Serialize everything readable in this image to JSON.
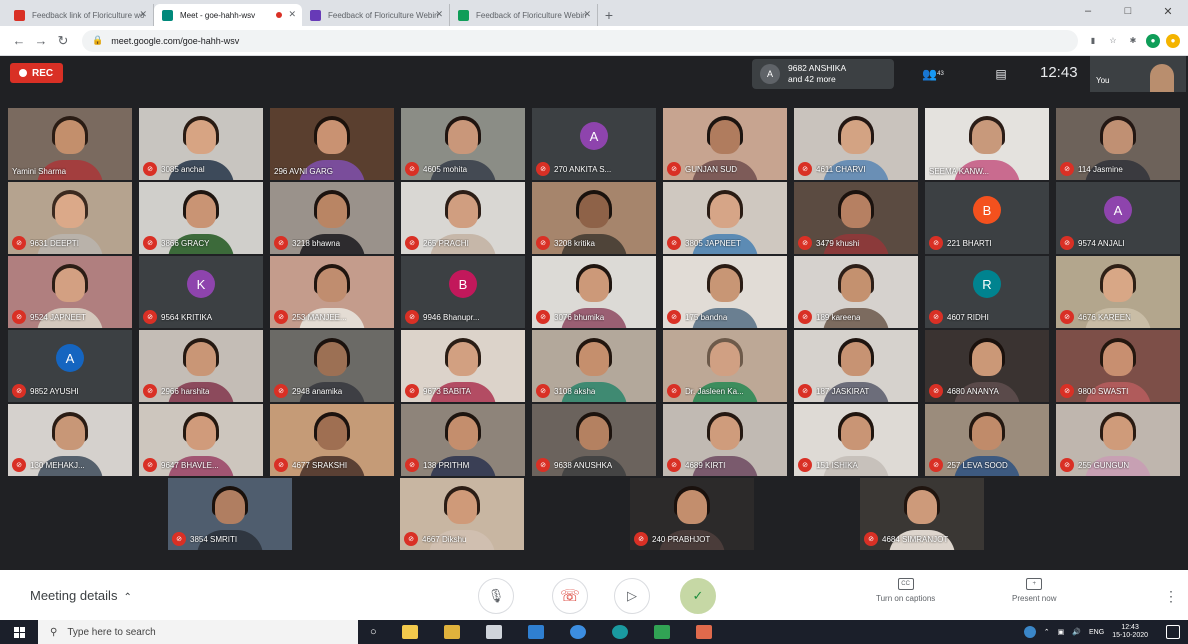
{
  "browser": {
    "tabs": [
      {
        "label": "Feedback link of Floriculture wo",
        "fav_color": "#d93025",
        "active": false
      },
      {
        "label": "Meet - goe-hahh-wsv",
        "fav_color": "#00897b",
        "active": true
      },
      {
        "label": "Feedback of Floriculture Webin",
        "fav_color": "#673ab7",
        "active": false
      },
      {
        "label": "Feedback of Floriculture Webin",
        "fav_color": "#0f9d58",
        "active": false
      }
    ],
    "url": "meet.google.com/goe-hahh-wsv"
  },
  "meet_top": {
    "rec_label": "REC",
    "presenter_initial": "A",
    "presenter_line1": "9682 ANSHIKA",
    "presenter_line2": "and 42 more",
    "participant_count": "43",
    "time": "12:43",
    "self_label": "You"
  },
  "participants": [
    {
      "name": "Yamini Sharma",
      "muted": false,
      "kind": "video",
      "bg": "#7a6a5f",
      "skin": "#c38f6c",
      "hair": "#2a1c14",
      "cloth": "#a33e3e"
    },
    {
      "name": "3085 anchal",
      "muted": true,
      "kind": "video",
      "bg": "#c8c5c0",
      "skin": "#d7a483",
      "hair": "#2a1c14",
      "cloth": "#3d4a5a"
    },
    {
      "name": "296 AVNI GARG",
      "muted": false,
      "kind": "video",
      "bg": "#5a3f2f",
      "skin": "#c99272",
      "hair": "#1c120c",
      "cloth": "#7a4d9b"
    },
    {
      "name": "4605 mohita",
      "muted": true,
      "kind": "video",
      "bg": "#8b8d86",
      "skin": "#c9977a",
      "hair": "#1f1410",
      "cloth": "#444a53"
    },
    {
      "name": "270 ANKITA S...",
      "muted": true,
      "kind": "letter",
      "letter": "A",
      "color": "#8e44ad"
    },
    {
      "name": "GUNJAN SUD",
      "muted": true,
      "kind": "video",
      "bg": "#c7a490",
      "skin": "#b07c5e",
      "hair": "#1c1410",
      "cloth": "#7d5b58"
    },
    {
      "name": "4611 CHARVI",
      "muted": true,
      "kind": "video",
      "bg": "#c9c3bd",
      "skin": "#d3a383",
      "hair": "#231713",
      "cloth": "#6a8fb5"
    },
    {
      "name": "SEEMA KANW...",
      "muted": false,
      "kind": "video",
      "bg": "#e4e2de",
      "skin": "#c8997b",
      "hair": "#2b1d17",
      "cloth": "#c96b8f"
    },
    {
      "name": "114 Jasmine",
      "muted": true,
      "kind": "video",
      "bg": "#6d625a",
      "skin": "#c09073",
      "hair": "#231713",
      "cloth": "#3a3a3f"
    },
    {
      "name": "9631 DEEPTI",
      "muted": true,
      "kind": "video",
      "bg": "#b5a38f",
      "skin": "#dba989",
      "hair": "#3b2a20",
      "cloth": "#b9b2aa"
    },
    {
      "name": "3866 GRACY",
      "muted": true,
      "kind": "video",
      "bg": "#d0cfcb",
      "skin": "#c99474",
      "hair": "#1e1510",
      "cloth": "#3c6a3a"
    },
    {
      "name": "3218 bhawna",
      "muted": true,
      "kind": "video",
      "bg": "#9a928b",
      "skin": "#b98564",
      "hair": "#1c130f",
      "cloth": "#2d2b2e"
    },
    {
      "name": "265 PRACHI",
      "muted": true,
      "kind": "video",
      "bg": "#d9d7d3",
      "skin": "#d09e80",
      "hair": "#2c1e17",
      "cloth": "#c6b7a9"
    },
    {
      "name": "3208 kritika",
      "muted": true,
      "kind": "video",
      "bg": "#a6856c",
      "skin": "#8e6248",
      "hair": "#1a120d",
      "cloth": "#4f4439"
    },
    {
      "name": "3805 JAPNEET",
      "muted": true,
      "kind": "video",
      "bg": "#cfc8c0",
      "skin": "#d6a587",
      "hair": "#2a1c14",
      "cloth": "#5c8bb4"
    },
    {
      "name": "3479 khushi",
      "muted": true,
      "kind": "video",
      "bg": "#5b4b41",
      "skin": "#b68062",
      "hair": "#1b120e",
      "cloth": "#8b3a3a"
    },
    {
      "name": "221 BHARTI",
      "muted": true,
      "kind": "letter",
      "letter": "B",
      "color": "#f4511e"
    },
    {
      "name": "9574 ANJALI",
      "muted": true,
      "kind": "letter",
      "letter": "A",
      "color": "#8e44ad"
    },
    {
      "name": "9524 JAPNEET",
      "muted": true,
      "kind": "video",
      "bg": "#b07f7f",
      "skin": "#d3a082",
      "hair": "#2c1d16",
      "cloth": "#d4c8bd"
    },
    {
      "name": "9564 KRITIKA",
      "muted": true,
      "kind": "letter",
      "letter": "K",
      "color": "#8e44ad"
    },
    {
      "name": "253 MANJEE...",
      "muted": true,
      "kind": "video",
      "bg": "#c49c8c",
      "skin": "#c08d6f",
      "hair": "#20150f",
      "cloth": "#e4dcd4"
    },
    {
      "name": "9946 Bhanupr...",
      "muted": true,
      "kind": "letter",
      "letter": "B",
      "color": "#c2185b"
    },
    {
      "name": "3076 bhumika",
      "muted": true,
      "kind": "video",
      "bg": "#dcdad6",
      "skin": "#cc9979",
      "hair": "#1f1510",
      "cloth": "#9a5f73"
    },
    {
      "name": "175 bandna",
      "muted": true,
      "kind": "video",
      "bg": "#e1dcd6",
      "skin": "#c89675",
      "hair": "#2a1c14",
      "cloth": "#6a7f91"
    },
    {
      "name": "189 kareena",
      "muted": true,
      "kind": "video",
      "bg": "#d6d2ce",
      "skin": "#c4916f",
      "hair": "#2d1f18",
      "cloth": "#7c6b5f"
    },
    {
      "name": "4607 RIDHI",
      "muted": true,
      "kind": "letter",
      "letter": "R",
      "color": "#00838f"
    },
    {
      "name": "4676 KAREEN",
      "muted": true,
      "kind": "video",
      "bg": "#b3a68d",
      "skin": "#d8a786",
      "hair": "#2e2016",
      "cloth": "#c9bda6"
    },
    {
      "name": "9852 AYUSHI",
      "muted": true,
      "kind": "letter",
      "letter": "A",
      "color": "#1565c0"
    },
    {
      "name": "2966 harshita",
      "muted": true,
      "kind": "video",
      "bg": "#c4bdb6",
      "skin": "#c99676",
      "hair": "#251912",
      "cloth": "#8c4a5c"
    },
    {
      "name": "2948 anamika",
      "muted": true,
      "kind": "video",
      "bg": "#6b6a66",
      "skin": "#9c7054",
      "hair": "#1b120e",
      "cloth": "#3e3f44"
    },
    {
      "name": "9673 BABITA",
      "muted": true,
      "kind": "video",
      "bg": "#dcd3ca",
      "skin": "#d2a081",
      "hair": "#2a1d15",
      "cloth": "#b34c63"
    },
    {
      "name": "3108 aksha",
      "muted": true,
      "kind": "video",
      "bg": "#b3a89b",
      "skin": "#c58f6d",
      "hair": "#22160f",
      "cloth": "#3f8a72"
    },
    {
      "name": "Dr. Jasleen Ka...",
      "muted": true,
      "kind": "video",
      "bg": "#bda896",
      "skin": "#d0a083",
      "hair": "#6d5a4a",
      "cloth": "#3c8d5d"
    },
    {
      "name": "187 JASKIRAT",
      "muted": true,
      "kind": "video",
      "bg": "#d6d2cd",
      "skin": "#c79373",
      "hair": "#1f1510",
      "cloth": "#6c6d7a"
    },
    {
      "name": "4680 ANANYA",
      "muted": true,
      "kind": "video",
      "bg": "#3a3331",
      "skin": "#cb9877",
      "hair": "#1a110d",
      "cloth": "#5a4a4a"
    },
    {
      "name": "9800 SWASTI",
      "muted": true,
      "kind": "video",
      "bg": "#7d4f48",
      "skin": "#c88f70",
      "hair": "#24170f",
      "cloth": "#b05b5b"
    },
    {
      "name": "130 MEHAKJ...",
      "muted": true,
      "kind": "video",
      "bg": "#d5d1cd",
      "skin": "#c89777",
      "hair": "#2a1c14",
      "cloth": "#55606c"
    },
    {
      "name": "9647 BHAVLE...",
      "muted": true,
      "kind": "video",
      "bg": "#cdc6be",
      "skin": "#d09b7b",
      "hair": "#241810",
      "cloth": "#a15572"
    },
    {
      "name": "4677 SRAKSHI",
      "muted": true,
      "kind": "video",
      "bg": "#c59b77",
      "skin": "#9f6f52",
      "hair": "#1b120e",
      "cloth": "#5a4034"
    },
    {
      "name": "138 PRITHM",
      "muted": true,
      "kind": "video",
      "bg": "#8e847a",
      "skin": "#c48e6d",
      "hair": "#1d140f",
      "cloth": "#3a3f55"
    },
    {
      "name": "9638 ANUSHKA",
      "muted": true,
      "kind": "video",
      "bg": "#6b635d",
      "skin": "#b48161",
      "hair": "#1c130e",
      "cloth": "#444"
    },
    {
      "name": "4689 KIRTI",
      "muted": true,
      "kind": "video",
      "bg": "#c1bab3",
      "skin": "#cf9c7c",
      "hair": "#241811",
      "cloth": "#7a5a6d"
    },
    {
      "name": "151 ISHIKA",
      "muted": true,
      "kind": "video",
      "bg": "#dedad5",
      "skin": "#c99575",
      "hair": "#20150f",
      "cloth": "#c7c1bb"
    },
    {
      "name": "257 LEVA SOOD",
      "muted": true,
      "kind": "video",
      "bg": "#9b8c7c",
      "skin": "#c08b6a",
      "hair": "#231710",
      "cloth": "#3d5a80"
    },
    {
      "name": "255 GUNGUN",
      "muted": true,
      "kind": "video",
      "bg": "#bfb6ae",
      "skin": "#cf9b7a",
      "hair": "#2a1b13",
      "cloth": "#c7a0b3"
    },
    {
      "name": "3854 SMRITI",
      "muted": true,
      "kind": "video",
      "bg": "#4f5d6e",
      "skin": "#b07e61",
      "hair": "#1a110c",
      "cloth": "#2f3640"
    },
    {
      "name": "4667 Dikshu",
      "muted": true,
      "kind": "video",
      "bg": "#c8b6a2",
      "skin": "#cf9a79",
      "hair": "#2b1d15",
      "cloth": "#d0bfb0"
    },
    {
      "name": "240 PRABHJOT",
      "muted": true,
      "kind": "video",
      "bg": "#2c2a2a",
      "skin": "#c38e6d",
      "hair": "#1a110d",
      "cloth": "#4a3c3a"
    },
    {
      "name": "4684 SIMRANJOT",
      "muted": true,
      "kind": "video",
      "bg": "#3a3734",
      "skin": "#cd9a7a",
      "hair": "#20150f",
      "cloth": "#ddd5cd"
    }
  ],
  "meet_bottom": {
    "details_label": "Meeting details",
    "captions_label": "Turn on captions",
    "captions_icon_text": "CC",
    "present_label": "Present now"
  },
  "taskbar": {
    "search_placeholder": "Type here to search",
    "lang": "ENG",
    "time": "12:43",
    "date": "15-10-2020"
  },
  "colors": {
    "meet_bg": "#202124",
    "rec_red": "#d93025",
    "mute_red": "#d93025",
    "check_green": "#1e8e3e"
  }
}
